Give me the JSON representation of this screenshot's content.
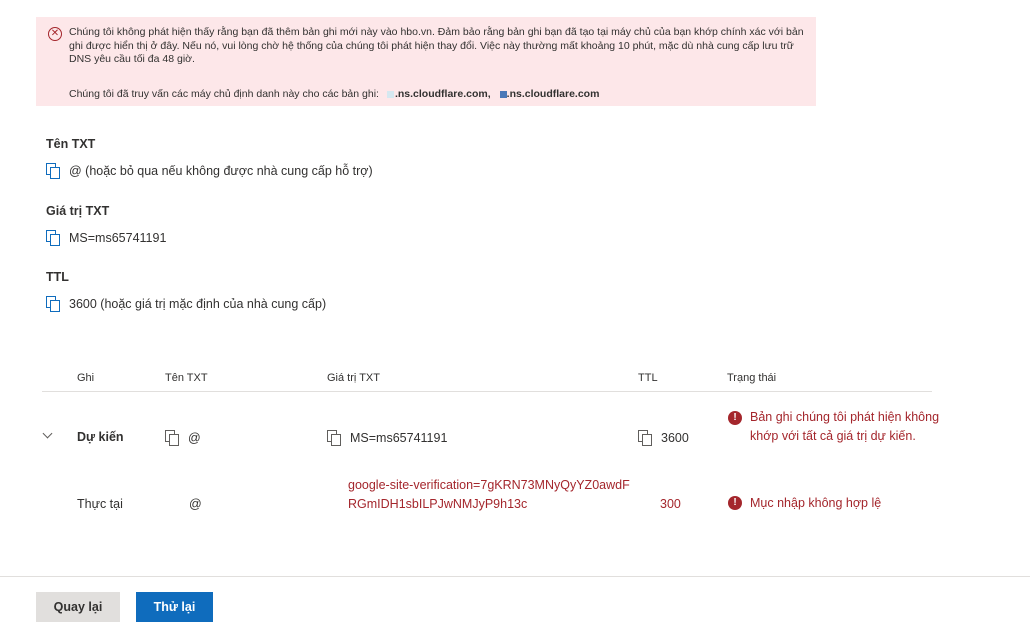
{
  "error": {
    "icon": "error-circle-icon",
    "message": "Chúng tôi không phát hiện thấy rằng bạn đã thêm bản ghi mới này vào hbo.vn. Đảm bảo rằng bản ghi bạn đã tạo tại máy chủ của bạn khớp chính xác với bản ghi được hiển thị ở đây. Nếu nó, vui lòng chờ hệ thống của chúng tôi phát hiện thay đổi. Việc này thường mất khoảng 10 phút, mặc dù nhà cung cấp lưu trữ DNS yêu cầu tối đa 48 giờ.",
    "ns_prefix": "Chúng tôi đã truy vấn các máy chủ định danh này cho các bản ghi:",
    "ns1": ".ns.cloudflare.com,",
    "ns2": ".ns.cloudflare.com"
  },
  "fields": {
    "txt_name_label": "Tên TXT",
    "txt_name_value": "@ (hoặc bỏ qua nếu không được nhà cung cấp hỗ trợ)",
    "txt_value_label": "Giá trị TXT",
    "txt_value_value": "MS=ms65741191",
    "ttl_label": "TTL",
    "ttl_value": "3600 (hoặc giá trị mặc định của nhà cung cấp)"
  },
  "table": {
    "headers": {
      "record": "Ghi",
      "txt_name": "Tên TXT",
      "txt_value": "Giá trị TXT",
      "ttl": "TTL",
      "status": "Trạng thái"
    },
    "expected": {
      "label": "Dự kiến",
      "name": "@",
      "value": "MS=ms65741191",
      "ttl": "3600",
      "status": "Bản ghi chúng tôi phát hiện không khớp với tất cả giá trị dự kiến."
    },
    "actual": {
      "label": "Thực tại",
      "name": "@",
      "value": "google-site-verification=7gKRN73MNyQyYZ0awdFRGmIDH1sbILPJwNMJyP9h13c",
      "ttl": "300",
      "status": "Mục nhập không hợp lệ"
    }
  },
  "buttons": {
    "back": "Quay lại",
    "retry": "Thử lại"
  },
  "colors": {
    "error_bg": "#fde7e9",
    "error_red": "#a4262c",
    "primary": "#0f6cbd"
  }
}
